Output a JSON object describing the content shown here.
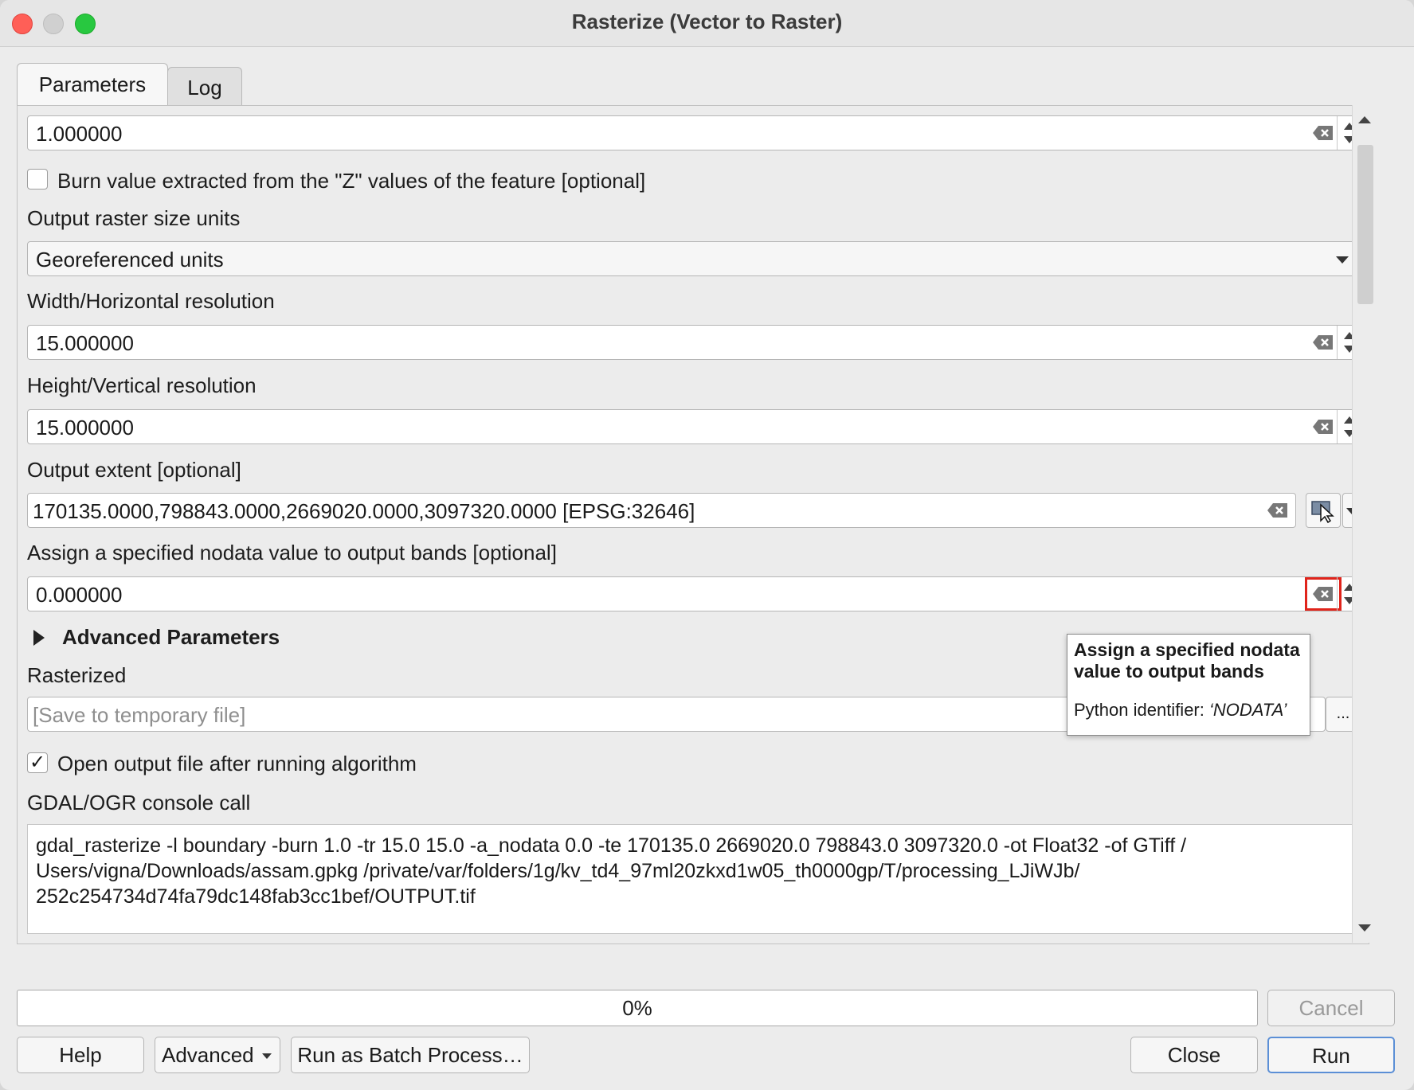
{
  "window": {
    "title": "Rasterize (Vector to Raster)"
  },
  "tabs": [
    {
      "label": "Parameters"
    },
    {
      "label": "Log"
    }
  ],
  "fields": {
    "burn_value": {
      "value": "1.000000"
    },
    "burn_z": {
      "label": "Burn value extracted from the \"Z\" values of the feature [optional]",
      "checked": false
    },
    "units": {
      "label": "Output raster size units",
      "value": "Georeferenced units"
    },
    "width": {
      "label": "Width/Horizontal resolution",
      "value": "15.000000"
    },
    "height": {
      "label": "Height/Vertical resolution",
      "value": "15.000000"
    },
    "extent": {
      "label": "Output extent [optional]",
      "value": "170135.0000,798843.0000,2669020.0000,3097320.0000 [EPSG:32646]"
    },
    "nodata": {
      "label": "Assign a specified nodata value to output bands [optional]",
      "value": "0.000000"
    },
    "advanced": {
      "label": "Advanced Parameters"
    },
    "rasterized": {
      "label": "Rasterized",
      "placeholder": "[Save to temporary file]",
      "browse_label": "..."
    },
    "open_output": {
      "label": "Open output file after running algorithm",
      "checked": true,
      "check_glyph": "✓"
    },
    "console": {
      "label": "GDAL/OGR console call",
      "lines": [
        "gdal_rasterize -l boundary -burn 1.0 -tr 15.0 15.0 -a_nodata 0.0 -te 170135.0 2669020.0 798843.0 3097320.0 -ot Float32 -of GTiff /",
        "Users/vigna/Downloads/assam.gpkg /private/var/folders/1g/kv_td4_97ml20zkxd1w05_th0000gp/T/processing_LJiWJb/",
        "252c254734d74fa79dc148fab3cc1bef/OUTPUT.tif"
      ]
    }
  },
  "tooltip": {
    "title": "Assign a specified nodata value to output bands",
    "id_prefix": "Python identifier: ",
    "id_value": "‘NODATA’"
  },
  "progress": {
    "percent": 0,
    "label": "0%"
  },
  "buttons": {
    "cancel": "Cancel",
    "help": "Help",
    "advanced": "Advanced",
    "batch": "Run as Batch Process…",
    "close": "Close",
    "run": "Run"
  },
  "colors": {
    "highlight": "#e0241b",
    "run_border": "#5b8fd6"
  },
  "icons": {
    "clear": "clear-field-icon",
    "spin": "spin-arrows-icon",
    "extent": "map-canvas-select-icon"
  }
}
